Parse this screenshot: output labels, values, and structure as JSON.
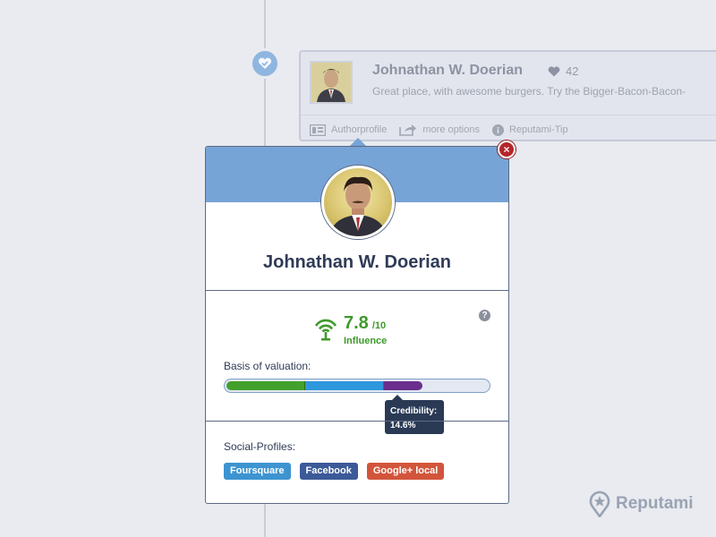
{
  "review": {
    "author_name": "Johnathan W. Doerian",
    "likes": "42",
    "text": "Great place, with awesome burgers. Try the Bigger-Bacon-Bacon-",
    "actions": {
      "authorprofile": "Authorprofile",
      "more_options": "more options",
      "tip": "Reputami-Tip"
    }
  },
  "profile": {
    "name": "Johnathan W. Doerian",
    "score": "7.8",
    "score_max": "/10",
    "score_label": "Influence",
    "basis_label": "Basis of valuation:",
    "basis_segments": [
      {
        "color": "#43a02c",
        "fraction": 0.3
      },
      {
        "color": "#2f97dc",
        "fraction": 0.3
      },
      {
        "color": "#6a2e8c",
        "fraction": 0.146
      }
    ],
    "tooltip_title": "Credibility:",
    "tooltip_value": "14.6%",
    "social_label": "Social-Profiles:",
    "social_tags": [
      {
        "label": "Foursquare",
        "color": "#3d94d0"
      },
      {
        "label": "Facebook",
        "color": "#3c5a98"
      },
      {
        "label": "Google+ local",
        "color": "#d2553b"
      }
    ],
    "close_label": "×",
    "help_label": "?"
  },
  "brand": {
    "name": "Reputami"
  },
  "colors": {
    "header": "#76a4d6",
    "influence": "#3e9a2b",
    "close": "#b5272a"
  },
  "icons": [
    "check-heart-icon",
    "heart-icon",
    "profile-card-icon",
    "share-icon",
    "info-icon",
    "signal-icon",
    "help-icon",
    "close-icon",
    "location-pin-icon"
  ]
}
